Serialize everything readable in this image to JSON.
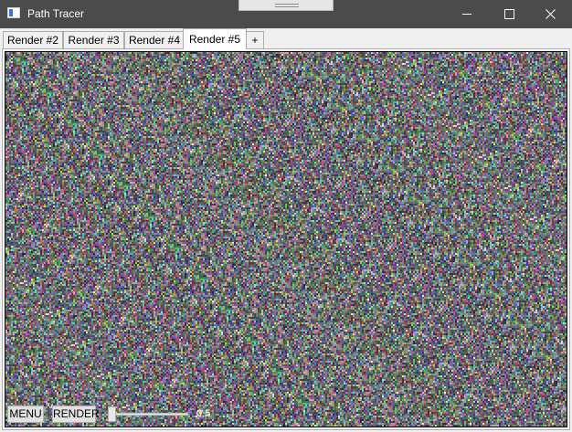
{
  "window": {
    "title": "Path Tracer",
    "icon": "app-window-icon",
    "controls": [
      "minimize-icon",
      "maximize-icon",
      "close-icon"
    ]
  },
  "tabs": [
    {
      "label": "Render #2",
      "active": false
    },
    {
      "label": "Render #3",
      "active": false
    },
    {
      "label": "Render #4",
      "active": false
    },
    {
      "label": "Render #5",
      "active": true
    },
    {
      "label": "+",
      "active": false
    }
  ],
  "render": {
    "description": "noise",
    "controls": {
      "menu_label": "MENU",
      "render_label": "RENDER",
      "slider_value_text": "0,5",
      "slider_fraction": 0.0
    }
  },
  "colors": {
    "titlebar": "#4b4b4b",
    "tab_background": "#f0f0f0",
    "active_tab_background": "#ffffff"
  }
}
